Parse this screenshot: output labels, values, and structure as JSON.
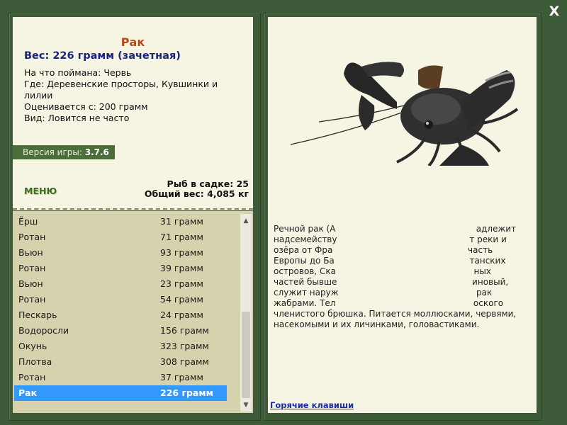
{
  "window": {
    "close_label": "X"
  },
  "fish": {
    "title": "Рак",
    "weight": "Вес: 226 грамм (зачетная)",
    "caught_with": "На что поймана: Червь",
    "location_line1": "Где: Деревенские просторы, Кувшинки и",
    "location_line2": "лилии",
    "rated_from": "Оценивается с: 200 грамм",
    "kind": "Вид: Ловится не часто"
  },
  "version": {
    "label": "Версия игры:",
    "value": "3.7.6"
  },
  "menu": {
    "label": "МЕНЮ"
  },
  "stats": {
    "fish_in_cage": "Рыб в садке: 25",
    "total_weight": "Общий вес: 4,085 кг"
  },
  "catch_list": [
    {
      "name": "Ёрш",
      "weight": "31 грамм"
    },
    {
      "name": "Ротан",
      "weight": "71 грамм"
    },
    {
      "name": "Вьюн",
      "weight": "93 грамм"
    },
    {
      "name": "Ротан",
      "weight": "39 грамм"
    },
    {
      "name": "Вьюн",
      "weight": "23 грамм"
    },
    {
      "name": "Ротан",
      "weight": "54 грамм"
    },
    {
      "name": "Пескарь",
      "weight": "24 грамм"
    },
    {
      "name": "Водоросли",
      "weight": "156 грамм"
    },
    {
      "name": "Окунь",
      "weight": "323 грамм"
    },
    {
      "name": "Плотва",
      "weight": "308 грамм"
    },
    {
      "name": "Ротан",
      "weight": "37 грамм"
    },
    {
      "name": "Рак",
      "weight": "226 грамм"
    }
  ],
  "description": {
    "line1": "Речной рак (А                                                    адлежит",
    "line2": "надсемейству                                                 т реки и",
    "line3": "озёра от Фра                                                  часть",
    "line4": "Европы до Ба                                                  танских",
    "line5": "островов, Ска                                                   ных",
    "line6": "частей бывше                                                  иновый,",
    "line7": "служит наруж                                                   рак",
    "line8": "жабрами. Тел                                                   оского",
    "line9": "членистого брюшка. Питается моллюсками, червями,",
    "line10": "насекомыми и их личинками, головастиками."
  },
  "hotkeys": {
    "label": "Горячие клавиши"
  },
  "icons": {
    "close": "close-icon",
    "up": "scroll-up-icon",
    "down": "scroll-down-icon",
    "crayfish": "crayfish-image"
  },
  "colors": {
    "background": "#3d5b38",
    "panel": "#f6f4e2",
    "list": "#d6d2ad",
    "selection": "#3399ff",
    "title": "#b94714",
    "weight": "#19257c"
  }
}
